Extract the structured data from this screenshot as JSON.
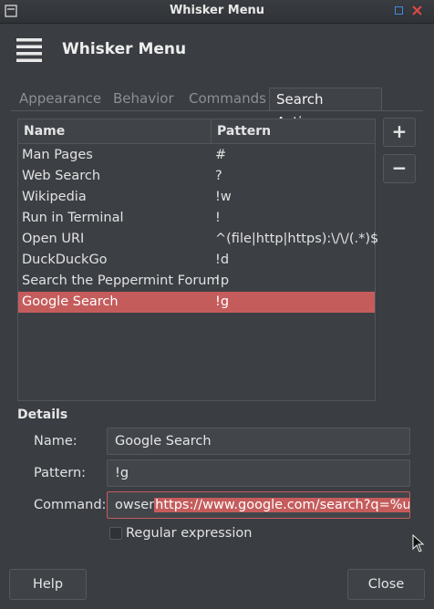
{
  "window": {
    "title": "Whisker Menu"
  },
  "header": {
    "title": "Whisker Menu",
    "icon": "hamburger-menu-icon"
  },
  "tabs": [
    {
      "label": "Appearance",
      "active": false
    },
    {
      "label": "Behavior",
      "active": false
    },
    {
      "label": "Commands",
      "active": false
    },
    {
      "label": "Search Actions",
      "active": true
    }
  ],
  "actions_table": {
    "columns": [
      "Name",
      "Pattern"
    ],
    "rows": [
      {
        "name": "Man Pages",
        "pattern": "#"
      },
      {
        "name": "Web Search",
        "pattern": "?"
      },
      {
        "name": "Wikipedia",
        "pattern": "!w"
      },
      {
        "name": "Run in Terminal",
        "pattern": "!"
      },
      {
        "name": "Open URI",
        "pattern": "^(file|http|https):\\/\\/(.*)$"
      },
      {
        "name": "DuckDuckGo",
        "pattern": "!d"
      },
      {
        "name": "Search the Peppermint Forum",
        "pattern": "!p"
      },
      {
        "name": "Google Search",
        "pattern": "!g"
      }
    ],
    "selected_index": 7
  },
  "side_buttons": {
    "add": "+",
    "remove": "−"
  },
  "details": {
    "title": "Details",
    "name_label": "Name:",
    "name_value": "Google Search",
    "pattern_label": "Pattern:",
    "pattern_value": "!g",
    "command_label": "Command:",
    "command_prefix": "owser",
    "command_selected": "https://www.google.com/search?q=%u",
    "regex_label": "Regular expression",
    "regex_checked": false
  },
  "buttons": {
    "help": "Help",
    "close": "Close"
  },
  "colors": {
    "accent": "#c55c5c",
    "maximize": "#3d8ee6",
    "close": "#e04848"
  }
}
